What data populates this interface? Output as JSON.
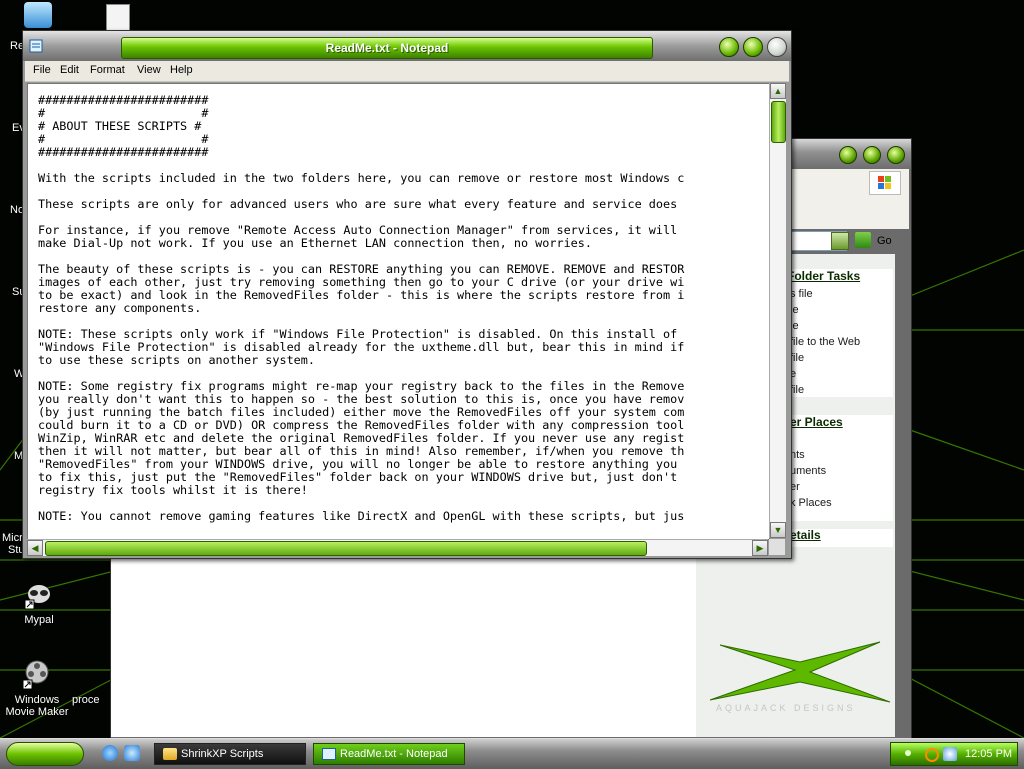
{
  "desktop": {
    "icons": [
      {
        "label": "Mypal"
      },
      {
        "label": "Windows Movie Maker"
      },
      {
        "label": "proce"
      }
    ],
    "edge_labels": [
      "Re",
      "Ev",
      "No",
      "Su",
      "W",
      "M",
      "Micro",
      "Stu"
    ]
  },
  "explorer": {
    "go_label": "Go",
    "folder_tasks_title": "Folder Tasks",
    "folder_tasks": [
      "s file",
      "le",
      "le",
      "file to the Web",
      "file",
      "e",
      "file"
    ],
    "other_places_title": "er Places",
    "other_places": [
      "nts",
      "uments",
      "er",
      "k Places"
    ],
    "details_title": "etails",
    "brand_text": "AQUAJACK DESIGNS"
  },
  "notepad": {
    "title": "ReadMe.txt - Notepad",
    "menus": [
      "File",
      "Edit",
      "Format",
      "View",
      "Help"
    ],
    "text": "########################\n#                      #\n# ABOUT THESE SCRIPTS #\n#                      #\n########################\n\nWith the scripts included in the two folders here, you can remove or restore most Windows c\n\nThese scripts are only for advanced users who are sure what every feature and service does\n\nFor instance, if you remove \"Remote Access Auto Connection Manager\" from services, it will\nmake Dial-Up not work. If you use an Ethernet LAN connection then, no worries.\n\nThe beauty of these scripts is - you can RESTORE anything you can REMOVE. REMOVE and RESTOR\nimages of each other, just try removing something then go to your C drive (or your drive wi\nto be exact) and look in the RemovedFiles folder - this is where the scripts restore from i\nrestore any components.\n\nNOTE: These scripts only work if \"Windows File Protection\" is disabled. On this install of\n\"Windows File Protection\" is disabled already for the uxtheme.dll but, bear this in mind if\nto use these scripts on another system.\n\nNOTE: Some registry fix programs might re-map your registry back to the files in the Remove\nyou really don't want this to happen so - the best solution to this is, once you have remov\n(by just running the batch files included) either move the RemovedFiles off your system com\ncould burn it to a CD or DVD) OR compress the RemovedFiles folder with any compression tool\nWinZip, WinRAR etc and delete the original RemovedFiles folder. If you never use any regist\nthen it will not matter, but bear all of this in mind! Also remember, if/when you remove th\n\"RemovedFiles\" from your WINDOWS drive, you will no longer be able to restore anything you\nto fix this, just put the \"RemovedFiles\" folder back on your WINDOWS drive but, just don't\nregistry fix tools whilst it is there!\n\nNOTE: You cannot remove gaming features like DirectX and OpenGL with these scripts, but jus"
  },
  "taskbar": {
    "tasks": [
      {
        "label": "ShrinkXP Scripts",
        "active": false
      },
      {
        "label": "ReadMe.txt - Notepad",
        "active": true
      }
    ],
    "clock": "12:05 PM"
  },
  "colors": {
    "accent_green": "#6bc400",
    "desktop_grid": "#3f8a00"
  }
}
